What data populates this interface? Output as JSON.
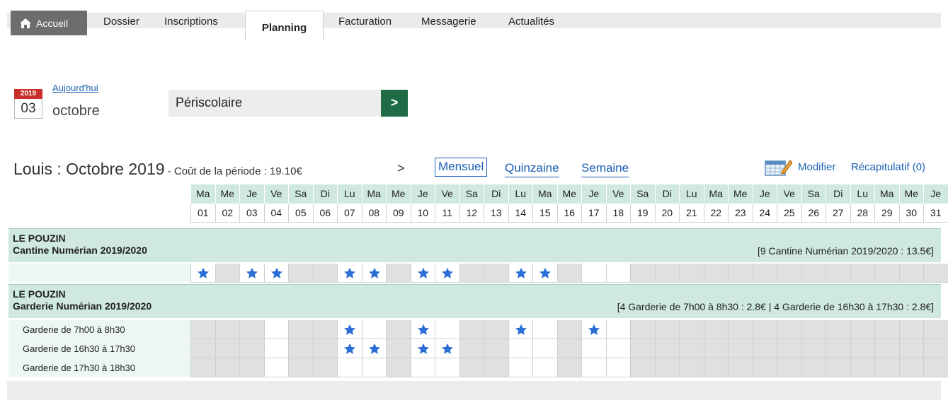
{
  "nav": {
    "home": "Accueil",
    "items": [
      "Dossier",
      "Inscriptions",
      "Planning",
      "Facturation",
      "Messagerie",
      "Actualités"
    ],
    "active": "Planning"
  },
  "date": {
    "year": "2019",
    "day": "03",
    "month": "octobre",
    "today_link": "Aujourd'hui"
  },
  "selector": {
    "value": "Périscolaire",
    "button": ">"
  },
  "period": {
    "title": "Louis : Octobre 2019",
    "cost": " - Coût de la période : 19.10€",
    "next": ">",
    "views": [
      "Mensuel",
      "Quinzaine",
      "Semaine"
    ],
    "active_view": "Mensuel",
    "modifier": "Modifier",
    "recap": "Récapitulatif (0)"
  },
  "days": [
    "Ma",
    "Me",
    "Je",
    "Ve",
    "Sa",
    "Di",
    "Lu",
    "Ma",
    "Me",
    "Je",
    "Ve",
    "Sa",
    "Di",
    "Lu",
    "Ma",
    "Me",
    "Je",
    "Ve",
    "Sa",
    "Di",
    "Lu",
    "Ma",
    "Me",
    "Je",
    "Ve",
    "Sa",
    "Di",
    "Lu",
    "Ma",
    "Me",
    "Je"
  ],
  "dates": [
    "01",
    "02",
    "03",
    "04",
    "05",
    "06",
    "07",
    "08",
    "09",
    "10",
    "11",
    "12",
    "13",
    "14",
    "15",
    "16",
    "17",
    "18",
    "19",
    "20",
    "21",
    "22",
    "23",
    "24",
    "25",
    "26",
    "27",
    "28",
    "29",
    "30",
    "31"
  ],
  "groups": [
    {
      "place": "LE POUZIN",
      "service": "Cantine Numérian 2019/2020",
      "summary": "[9 Cantine Numérian 2019/2020 : 13.5€]",
      "rows": [
        {
          "label": "",
          "open": [
            1,
            3,
            4,
            7,
            8,
            10,
            11,
            14,
            15,
            17,
            18
          ],
          "stars": [
            1,
            3,
            4,
            7,
            8,
            10,
            11,
            14,
            15
          ]
        }
      ]
    },
    {
      "place": "LE POUZIN",
      "service": "Garderie Numérian 2019/2020",
      "summary": "[4 Garderie de 7h00 à 8h30 : 2.8€ | 4 Garderie de 16h30 à 17h30 : 2.8€]",
      "rows": [
        {
          "label": "Garderie de 7h00 à 8h30",
          "open": [
            4,
            7,
            8,
            10,
            11,
            14,
            15,
            17,
            18
          ],
          "stars": [
            7,
            10,
            14,
            17
          ]
        },
        {
          "label": "Garderie de 16h30 à 17h30",
          "open": [
            4,
            7,
            8,
            10,
            11,
            14,
            15,
            17,
            18
          ],
          "stars": [
            7,
            8,
            10,
            11
          ]
        },
        {
          "label": "Garderie de 17h30 à 18h30",
          "open": [
            4,
            7,
            8,
            10,
            11,
            14,
            15,
            17,
            18
          ],
          "stars": []
        }
      ]
    }
  ],
  "colors": {
    "accent": "#1a5fb4",
    "header_teal": "#cfe8e2",
    "star": "#2b6fd6",
    "go_button": "#1e6b45",
    "year_red": "#c9302c"
  }
}
